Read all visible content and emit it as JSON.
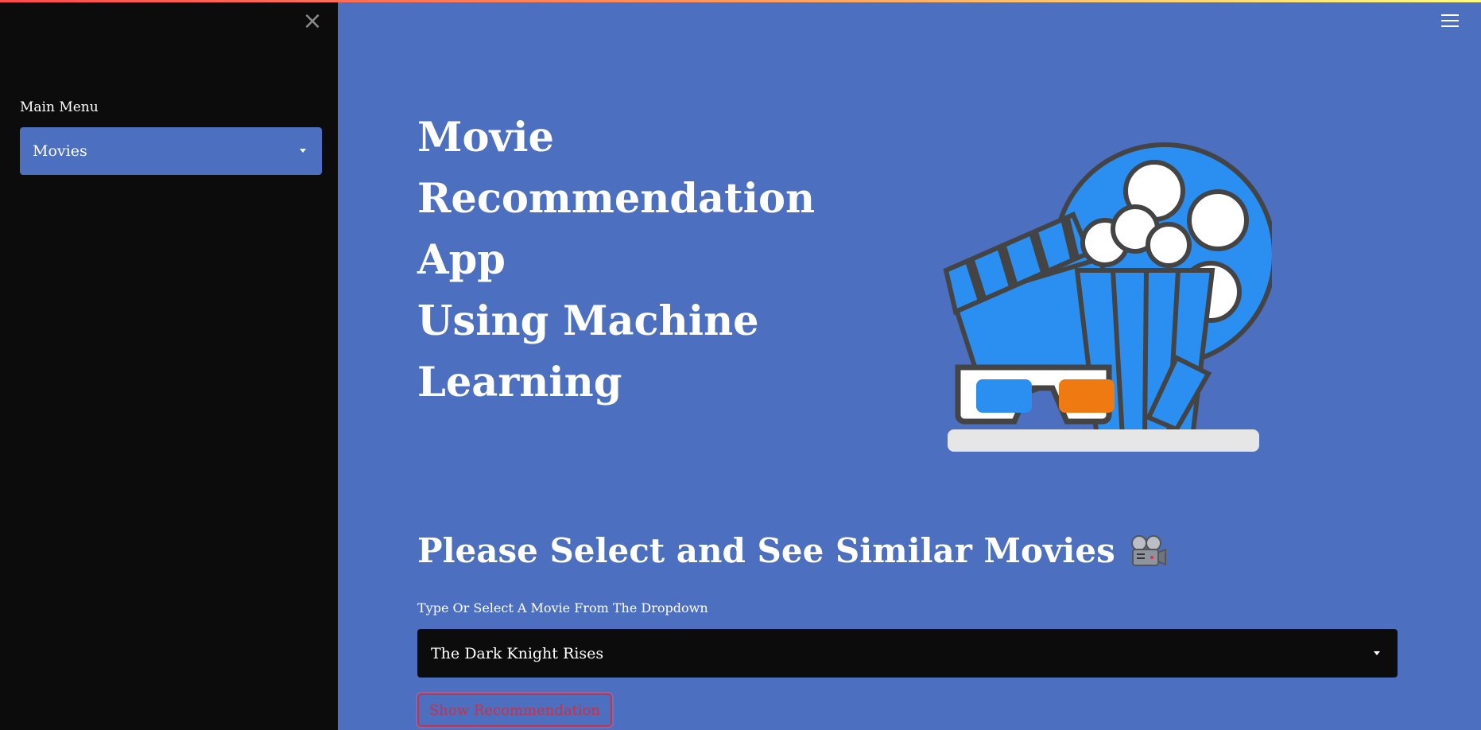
{
  "sidebar": {
    "close_icon": "close-icon",
    "menu_label": "Main Menu",
    "menu_selected": "Movies"
  },
  "header": {
    "menu_icon": "hamburger-icon"
  },
  "main": {
    "title_lines": [
      "Movie",
      "Recommendation App",
      "Using Machine",
      "Learning"
    ],
    "hero_image": "cinema-illustration",
    "section_heading": "Please Select and See Similar Movies",
    "section_icon": "movie-camera-icon",
    "select_label": "Type Or Select A Movie From The Dropdown",
    "selected_movie": "The Dark Knight Rises",
    "button_label": "Show Recommendation"
  },
  "colors": {
    "main_bg": "#4d6fbf",
    "sidebar_bg": "#0c0c0c",
    "button_text": "#c2334d",
    "accent_blue": "#2a8ff0",
    "accent_orange": "#f07a12"
  }
}
